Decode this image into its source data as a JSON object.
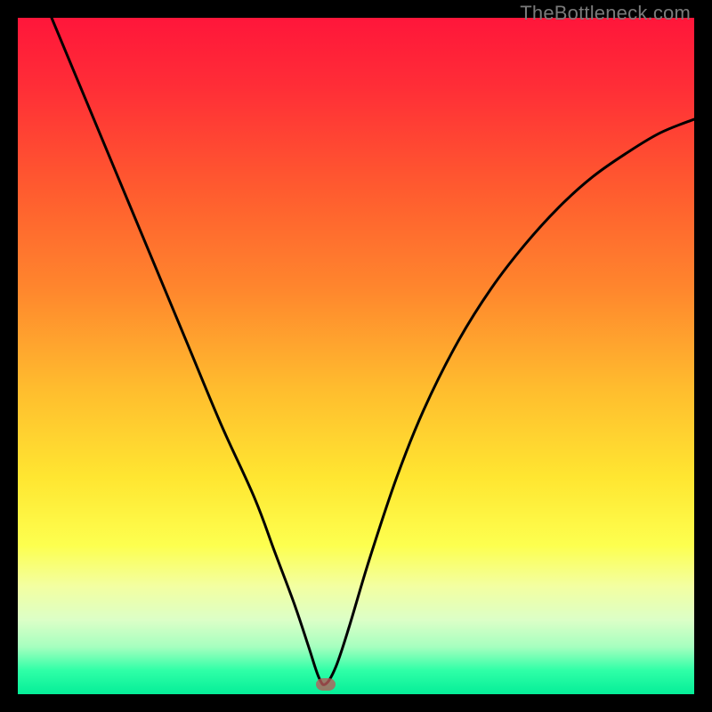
{
  "watermark": "TheBottleneck.com",
  "gradient": {
    "stops": [
      {
        "offset": 0.0,
        "color": "#ff163a"
      },
      {
        "offset": 0.1,
        "color": "#ff2d37"
      },
      {
        "offset": 0.25,
        "color": "#ff5a2f"
      },
      {
        "offset": 0.4,
        "color": "#ff862d"
      },
      {
        "offset": 0.55,
        "color": "#ffbd2e"
      },
      {
        "offset": 0.68,
        "color": "#ffe631"
      },
      {
        "offset": 0.78,
        "color": "#fdff4f"
      },
      {
        "offset": 0.84,
        "color": "#f3ffa1"
      },
      {
        "offset": 0.89,
        "color": "#dcffc7"
      },
      {
        "offset": 0.93,
        "color": "#a6ffbf"
      },
      {
        "offset": 0.965,
        "color": "#2fffa7"
      },
      {
        "offset": 1.0,
        "color": "#05ee98"
      }
    ]
  },
  "marker": {
    "x_frac": 0.455,
    "y_frac": 0.985,
    "color": "rgba(186,90,90,0.78)"
  },
  "curve": {
    "stroke": "#000000",
    "width": 3
  },
  "chart_data": {
    "type": "line",
    "title": "",
    "xlabel": "",
    "ylabel": "",
    "xlim": [
      0,
      100
    ],
    "ylim": [
      0,
      100
    ],
    "series": [
      {
        "name": "bottleneck-curve",
        "x": [
          5,
          10,
          15,
          20,
          25,
          30,
          35,
          38,
          41,
          43,
          44.5,
          45.5,
          47,
          49,
          52,
          56,
          60,
          65,
          70,
          75,
          80,
          85,
          90,
          95,
          100
        ],
        "y": [
          100,
          88,
          76,
          64,
          52,
          40,
          29,
          21,
          13,
          7,
          2.5,
          1.5,
          4,
          10,
          20,
          32,
          42,
          52,
          60,
          66.5,
          72,
          76.5,
          80,
          83,
          85
        ]
      }
    ],
    "marker_point": {
      "x": 45.5,
      "y": 1.5
    },
    "note": "x and y are percent of plot width/height; y=0 is bottom (green), y=100 is top (red). Values estimated from pixels."
  }
}
